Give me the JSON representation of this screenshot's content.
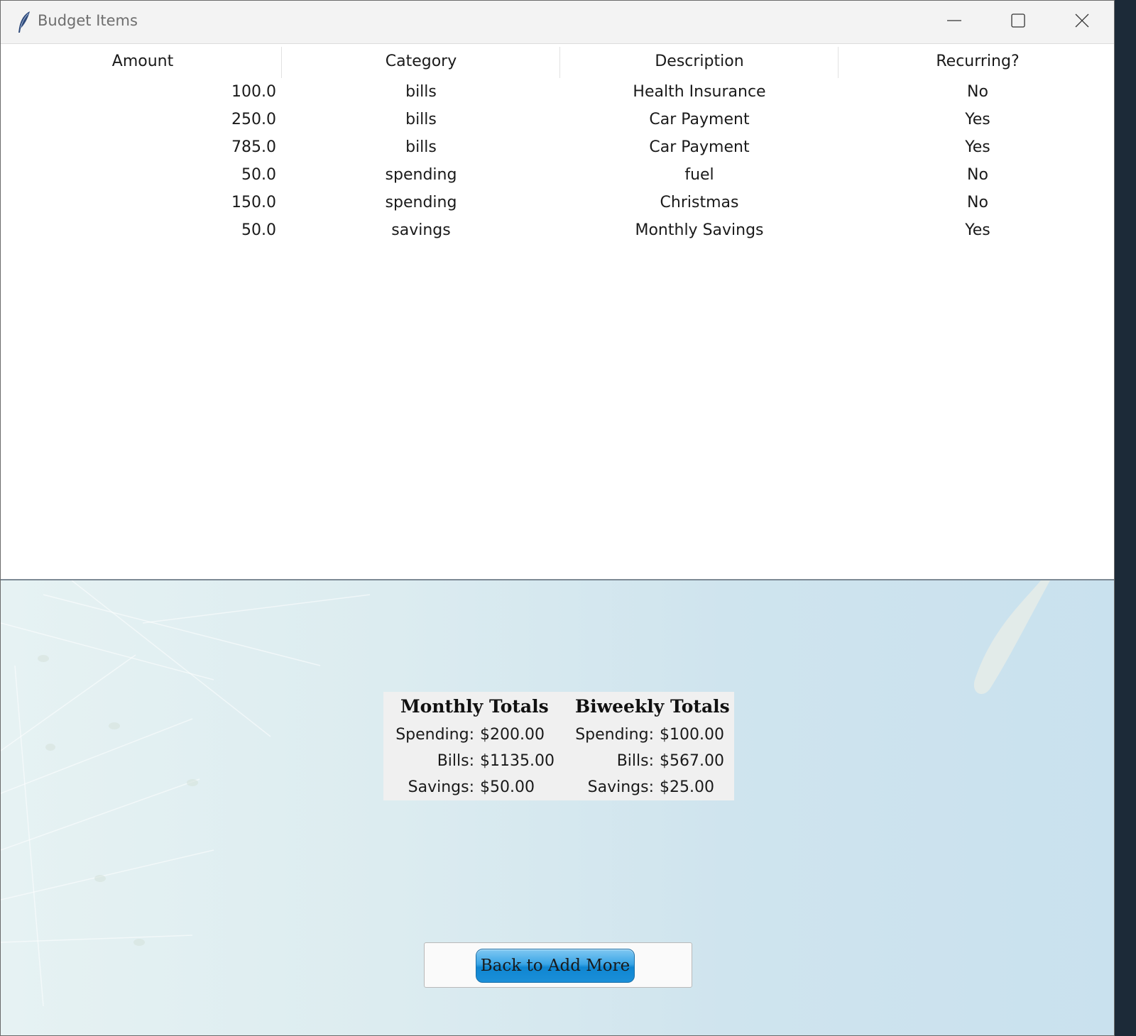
{
  "window": {
    "title": "Budget Items"
  },
  "table": {
    "headers": [
      "Amount",
      "Category",
      "Description",
      "Recurring?"
    ],
    "rows": [
      [
        "100.0",
        "bills",
        "Health Insurance",
        "No"
      ],
      [
        "250.0",
        "bills",
        "Car Payment",
        "Yes"
      ],
      [
        "785.0",
        "bills",
        "Car Payment",
        "Yes"
      ],
      [
        "50.0",
        "spending",
        "fuel",
        "No"
      ],
      [
        "150.0",
        "spending",
        "Christmas",
        "No"
      ],
      [
        "50.0",
        "savings",
        "Monthly Savings",
        "Yes"
      ]
    ]
  },
  "totals": {
    "monthly": {
      "heading": "Monthly Totals",
      "spending_label": "Spending:",
      "spending_value": "$200.00",
      "bills_label": "Bills:",
      "bills_value": "$1135.00",
      "savings_label": "Savings:",
      "savings_value": "$50.00"
    },
    "biweekly": {
      "heading": "Biweekly Totals",
      "spending_label": "Spending:",
      "spending_value": "$100.00",
      "bills_label": "Bills:",
      "bills_value": "$567.00",
      "savings_label": "Savings:",
      "savings_value": "$25.00"
    }
  },
  "actions": {
    "back_label": "Back to Add More"
  },
  "icons": {
    "app": "feather-icon",
    "minimize": "minimize-icon",
    "maximize": "maximize-icon",
    "close": "close-icon"
  },
  "colors": {
    "button_blue": "#1b8fd8",
    "panel_gray": "#f0f0f0",
    "background_blue": "#cfe4ee"
  }
}
